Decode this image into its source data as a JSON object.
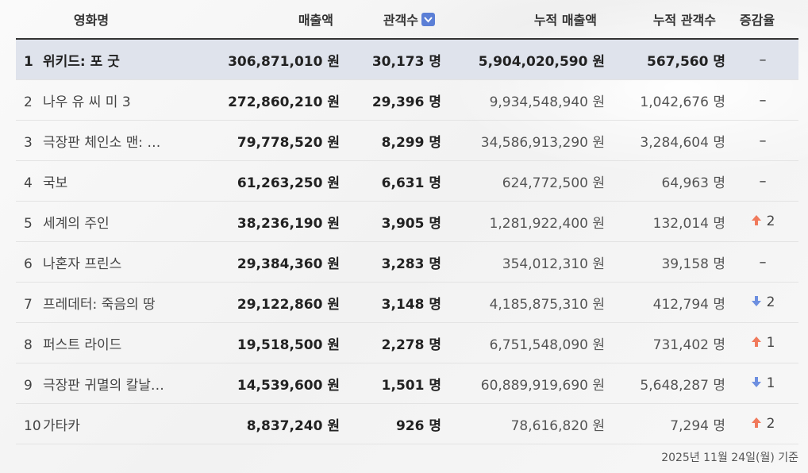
{
  "header": {
    "title": "영화명",
    "sales": "매출액",
    "audience": "관객수",
    "cum_sales": "누적 매출액",
    "cum_audience": "누적 관객수",
    "change": "증감율"
  },
  "rows": [
    {
      "rank": "1",
      "title": "위키드: 포 굿",
      "sales": "306,871,010 원",
      "audience": "30,173 명",
      "cum_sales": "5,904,020,590 원",
      "cum_audience": "567,560 명",
      "change_dir": "none",
      "change": "–"
    },
    {
      "rank": "2",
      "title": "나우 유 씨 미 3",
      "sales": "272,860,210 원",
      "audience": "29,396 명",
      "cum_sales": "9,934,548,940 원",
      "cum_audience": "1,042,676 명",
      "change_dir": "none",
      "change": "–"
    },
    {
      "rank": "3",
      "title": "극장판 체인소 맨: …",
      "sales": "79,778,520 원",
      "audience": "8,299 명",
      "cum_sales": "34,586,913,290 원",
      "cum_audience": "3,284,604 명",
      "change_dir": "none",
      "change": "–"
    },
    {
      "rank": "4",
      "title": "국보",
      "sales": "61,263,250 원",
      "audience": "6,631 명",
      "cum_sales": "624,772,500 원",
      "cum_audience": "64,963 명",
      "change_dir": "none",
      "change": "–"
    },
    {
      "rank": "5",
      "title": "세계의 주인",
      "sales": "38,236,190 원",
      "audience": "3,905 명",
      "cum_sales": "1,281,922,400 원",
      "cum_audience": "132,014 명",
      "change_dir": "up",
      "change": "2"
    },
    {
      "rank": "6",
      "title": "나혼자 프린스",
      "sales": "29,384,360 원",
      "audience": "3,283 명",
      "cum_sales": "354,012,310 원",
      "cum_audience": "39,158 명",
      "change_dir": "none",
      "change": "–"
    },
    {
      "rank": "7",
      "title": "프레데터: 죽음의 땅",
      "sales": "29,122,860 원",
      "audience": "3,148 명",
      "cum_sales": "4,185,875,310 원",
      "cum_audience": "412,794 명",
      "change_dir": "down",
      "change": "2"
    },
    {
      "rank": "8",
      "title": "퍼스트 라이드",
      "sales": "19,518,500 원",
      "audience": "2,278 명",
      "cum_sales": "6,751,548,090 원",
      "cum_audience": "731,402 명",
      "change_dir": "up",
      "change": "1"
    },
    {
      "rank": "9",
      "title": "극장판 귀멸의 칼날…",
      "sales": "14,539,600 원",
      "audience": "1,501 명",
      "cum_sales": "60,889,919,690 원",
      "cum_audience": "5,648,287 명",
      "change_dir": "down",
      "change": "1"
    },
    {
      "rank": "10",
      "title": "가타카",
      "sales": "8,837,240 원",
      "audience": "926 명",
      "cum_sales": "78,616,820 원",
      "cum_audience": "7,294 명",
      "change_dir": "up",
      "change": "2"
    }
  ],
  "footer": {
    "note": "2025년 11월 24일(월) 기준"
  },
  "colors": {
    "highlight_row": "#dfe3ec",
    "sort_button": "#5b7fd6",
    "arrow_up": "#f07a5c",
    "arrow_down": "#6d8fe0"
  },
  "icons": {
    "sort": "chevron-down-icon",
    "up": "arrow-up-icon",
    "down": "arrow-down-icon"
  }
}
